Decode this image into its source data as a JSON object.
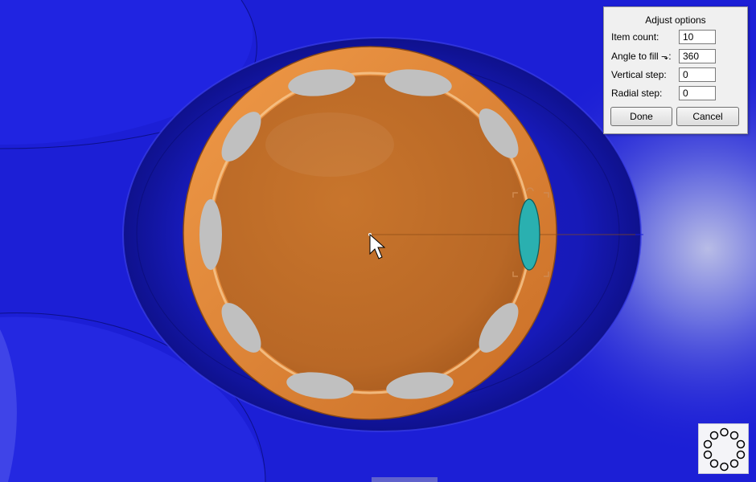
{
  "dialog": {
    "title": "Adjust options",
    "fields": [
      {
        "label": "Item count:",
        "value": "10"
      },
      {
        "label": "Angle to fill",
        "icon": "rotate-arrow-icon",
        "suffix": ":",
        "value": "360"
      },
      {
        "label": "Vertical step:",
        "value": "0"
      },
      {
        "label": "Radial step:",
        "value": "0"
      }
    ],
    "done_label": "Done",
    "cancel_label": "Cancel"
  },
  "model": {
    "colors": {
      "background": "#1c1fd6",
      "disc": "#c46f28",
      "rim": "#e08a3a",
      "ellipse": "#c0c0c0",
      "selected": "#2ab0b0"
    },
    "ellipse_count": 10,
    "selected_index": 0
  },
  "preset_icon": "circle-pattern-icon"
}
